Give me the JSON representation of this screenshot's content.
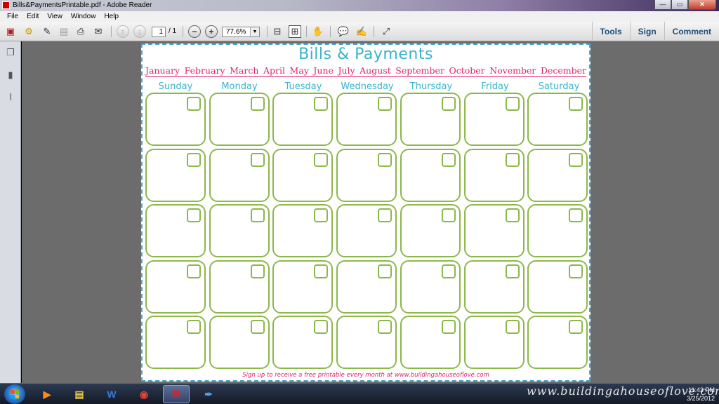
{
  "window": {
    "title": "Bills&PaymentsPrintable.pdf - Adobe Reader"
  },
  "window_controls": {
    "minimize": "—",
    "maximize": "▭",
    "close": "✕"
  },
  "menu": [
    "File",
    "Edit",
    "View",
    "Window",
    "Help"
  ],
  "toolbar": {
    "icons": [
      "create-pdf-icon",
      "settings-icon",
      "edit-icon",
      "save-icon",
      "print-icon",
      "email-icon",
      "prev-page-icon",
      "next-page-icon",
      "zoom-out-icon",
      "zoom-in-icon",
      "fit-page-icon",
      "fit-width-icon",
      "hand-tool-icon",
      "comment-icon",
      "highlight-icon",
      "expand-icon"
    ],
    "page_current": "1",
    "page_total": "/ 1",
    "zoom": "77.6%",
    "zoom_out": "−",
    "zoom_in": "+",
    "right_links": {
      "tools": "Tools",
      "sign": "Sign",
      "comment": "Comment"
    }
  },
  "document": {
    "title": "Bills & Payments",
    "months": [
      "January",
      "February",
      "March",
      "April",
      "May",
      "June",
      "July",
      "August",
      "September",
      "October",
      "November",
      "December"
    ],
    "days": [
      "Sunday",
      "Monday",
      "Tuesday",
      "Wednesday",
      "Thursday",
      "Friday",
      "Saturday"
    ],
    "rows": 5,
    "footer": "Sign up to receive a free printable every month at www.buildingahouseoflove.com",
    "colors": {
      "title": "#39b3cc",
      "months": "#e2246f",
      "cells": "#8cb84a",
      "border": "#4aa6cf"
    }
  },
  "taskbar": {
    "apps": [
      "media-player-icon",
      "file-explorer-icon",
      "word-icon",
      "chrome-icon",
      "adobe-reader-icon",
      "paint-icon"
    ],
    "time": "11:43 PM",
    "date": "3/25/2012"
  },
  "watermark": "www.buildingahouseoflove.com"
}
